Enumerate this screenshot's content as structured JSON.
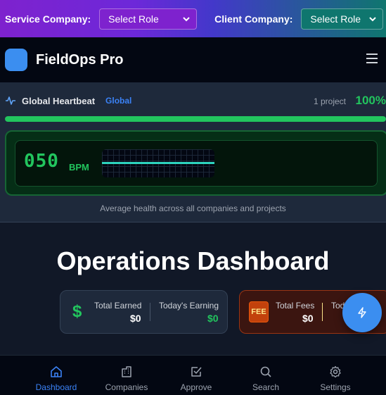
{
  "role_bar": {
    "service_label": "Service Company:",
    "service_select": "Select Role",
    "client_label": "Client Company:",
    "client_select": "Select Role"
  },
  "app": {
    "title": "FieldOps Pro",
    "logo_color": "#3b8ef0"
  },
  "heartbeat": {
    "title": "Global Heartbeat",
    "tag": "Global",
    "project_count": "1 project",
    "percent_label": "100%",
    "health_fraction": 1.0,
    "bpm": "050",
    "bpm_unit": "BPM",
    "caption": "Average health across all companies and projects"
  },
  "dashboard": {
    "title": "Operations Dashboard",
    "earnings": {
      "total_label": "Total Earned",
      "total_value": "$0",
      "today_label": "Today's Earning",
      "today_value": "$0"
    },
    "fees": {
      "badge": "FEE",
      "total_label": "Total Fees",
      "total_value": "$0",
      "today_label": "Tod"
    }
  },
  "nav": {
    "items": [
      {
        "label": "Dashboard",
        "icon": "home-icon"
      },
      {
        "label": "Companies",
        "icon": "building-icon"
      },
      {
        "label": "Approve",
        "icon": "check-square-icon"
      },
      {
        "label": "Search",
        "icon": "search-icon"
      },
      {
        "label": "Settings",
        "icon": "gear-icon"
      }
    ],
    "active_index": 0
  },
  "colors": {
    "accent": "#3b8ef0",
    "health_green": "#22c55e",
    "nav_active": "#3b82f6"
  }
}
